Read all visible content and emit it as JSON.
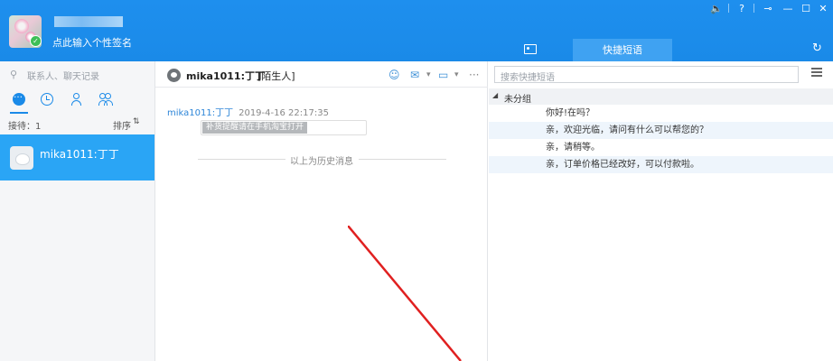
{
  "header": {
    "signature": "点此输入个性签名",
    "window_controls": [
      "🔈",
      "?",
      "⊸",
      "—",
      "☐",
      "✕"
    ],
    "tabs": [
      {
        "label": "",
        "icon": "contact-card-icon"
      },
      {
        "label": "快捷短语",
        "icon": ""
      }
    ],
    "refresh_icon": "↻"
  },
  "left_panel": {
    "search_placeholder": "联系人、聊天记录",
    "search_icon": "⚲",
    "sort": {
      "left": "接待：1",
      "right": "排序",
      "arrow": "⇅"
    },
    "contacts": [
      {
        "name": "mika1011:丁丁"
      }
    ]
  },
  "chat": {
    "title": "mika1011:丁丁",
    "tag": "[陌生人]",
    "toolbar": [
      "☺",
      "✉",
      "▾",
      "▭",
      "▾",
      "···"
    ],
    "message": {
      "sender": "mika1011:丁丁",
      "time": "2019-4-16 22:17:35",
      "text": "补货提醒请在手机淘宝打开"
    },
    "history_divider": "以上为历史消息"
  },
  "quick_phrases": {
    "search_placeholder": "搜索快捷短语",
    "group_arrow": "◢",
    "group_name": "未分组",
    "items": [
      "你好!在吗？",
      "亲，欢迎光临，请问有什么可以帮您的？",
      "亲，请稍等。",
      "亲，订单价格已经改好，可以付款啦。"
    ]
  },
  "colors": {
    "header_blue": "#1a8ae8",
    "selected_contact": "#2aa5f5",
    "annotation_arrow": "#e02020"
  }
}
